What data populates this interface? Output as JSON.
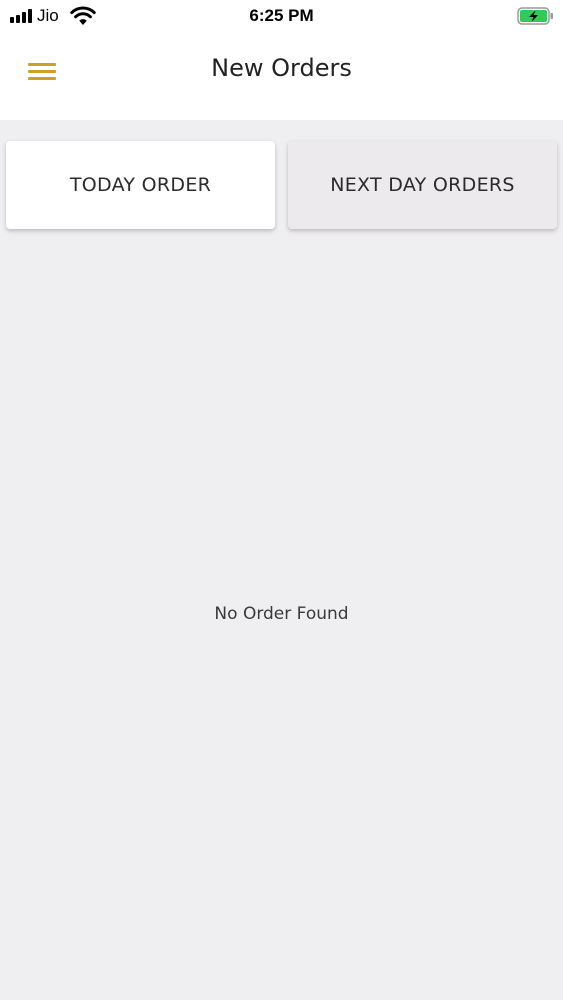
{
  "status_bar": {
    "carrier": "Jio",
    "time": "6:25 PM",
    "signal_bars": 4,
    "wifi_icon": "wifi-icon",
    "battery_icon": "battery-charging-icon",
    "battery_color": "#34c759"
  },
  "header": {
    "title": "New Orders",
    "menu_icon": "hamburger-menu-icon",
    "accent_color": "#c9a227"
  },
  "tabs": [
    {
      "label": "TODAY ORDER",
      "selected": true
    },
    {
      "label": "NEXT DAY ORDERS",
      "selected": false
    }
  ],
  "content": {
    "empty_message": "No Order Found"
  }
}
